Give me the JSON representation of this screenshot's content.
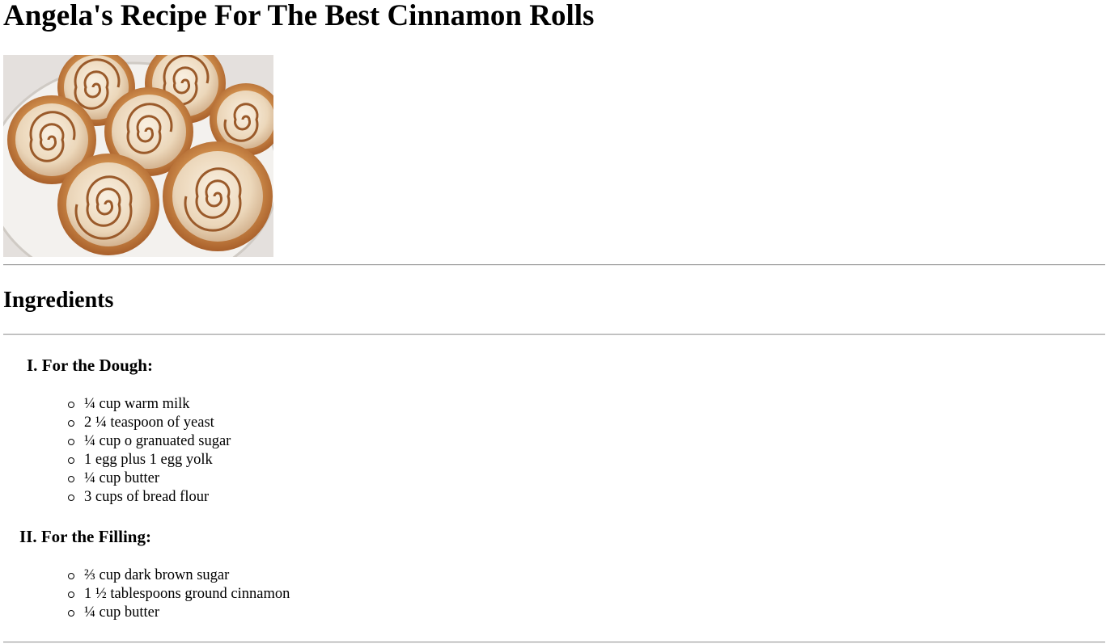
{
  "page": {
    "title": "Angela's Recipe For The Best Cinnamon Rolls"
  },
  "hero_image": {
    "subject": "cinnamon rolls with icing on a white plate"
  },
  "ingredients": {
    "heading": "Ingredients",
    "groups": [
      {
        "number": "I.",
        "title": "For the Dough:",
        "items": [
          "¼ cup warm milk",
          "2 ¼ teaspoon of yeast",
          "¼ cup o granuated sugar",
          "1 egg plus 1 egg yolk",
          "¼ cup butter",
          "3 cups of bread flour"
        ]
      },
      {
        "number": "II.",
        "title": "For the Filling:",
        "items": [
          "⅔ cup dark brown sugar",
          "1 ½ tablespoons ground cinnamon",
          "¼ cup butter"
        ]
      }
    ]
  },
  "colors": {
    "text": "#000000",
    "background": "#ffffff",
    "rule": "#9a9a9a"
  }
}
